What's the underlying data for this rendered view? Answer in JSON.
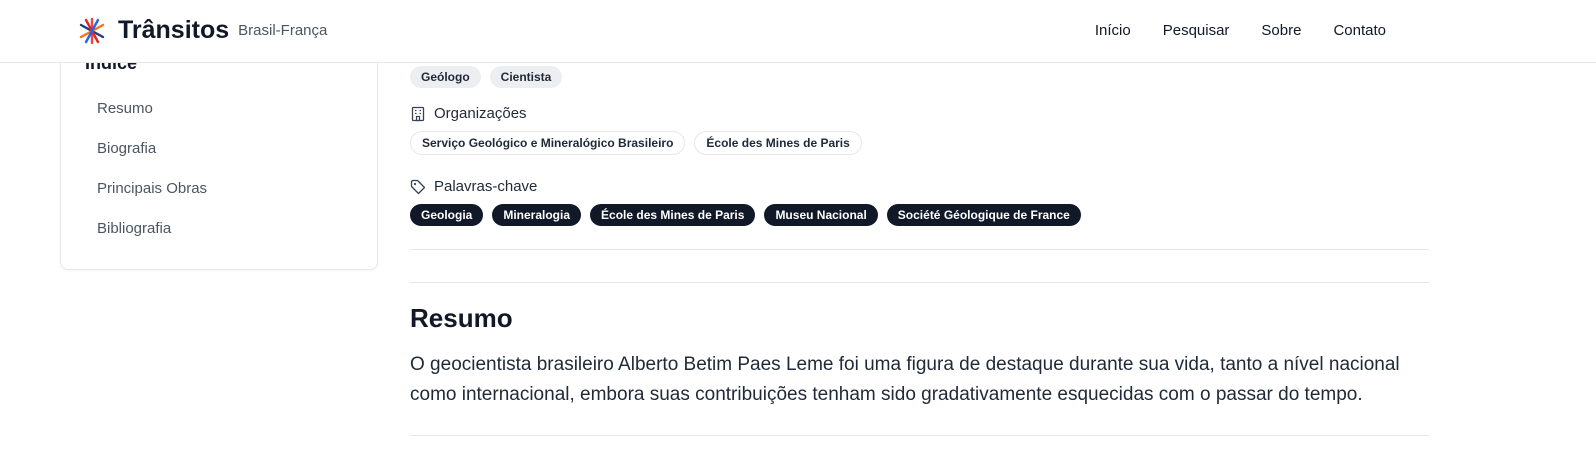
{
  "header": {
    "brand_name": "Trânsitos",
    "brand_sub": "Brasil-França",
    "nav": [
      "Início",
      "Pesquisar",
      "Sobre",
      "Contato"
    ]
  },
  "sidebar": {
    "title": "Índice",
    "items": [
      "Resumo",
      "Biografia",
      "Principais Obras",
      "Bibliografia"
    ]
  },
  "profile": {
    "occupations": [
      "Geólogo",
      "Cientista"
    ],
    "organizations_label": "Organizações",
    "organizations": [
      "Serviço Geológico e Mineralógico Brasileiro",
      "École des Mines de Paris"
    ],
    "keywords_label": "Palavras-chave",
    "keywords": [
      "Geologia",
      "Mineralogia",
      "École des Mines de Paris",
      "Museu Nacional",
      "Société Géologique de France"
    ]
  },
  "resumo": {
    "title": "Resumo",
    "text": "O geocientista brasileiro Alberto Betim Paes Leme foi uma figura de destaque durante sua vida, tanto a nível nacional como internacional, embora suas contribuições tenham sido gradativamente esquecidas com o passar do tempo."
  }
}
